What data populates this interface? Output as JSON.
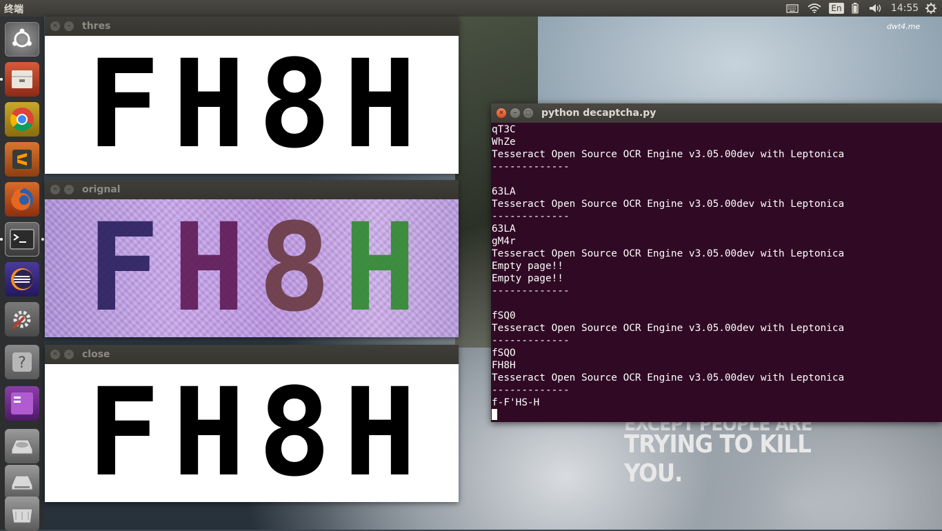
{
  "top_panel": {
    "title": "终端",
    "keyboard_indicator": "En",
    "clock": "14:55",
    "icons": [
      "keyboard-icon",
      "wifi-icon",
      "language-indicator",
      "battery-icon",
      "volume-icon",
      "gear-icon"
    ]
  },
  "launcher": {
    "items": [
      {
        "name": "ubuntu-dash-icon"
      },
      {
        "name": "files-icon"
      },
      {
        "name": "chrome-icon"
      },
      {
        "name": "sublime-text-icon"
      },
      {
        "name": "firefox-icon"
      },
      {
        "name": "terminal-icon"
      },
      {
        "name": "eclipse-icon"
      },
      {
        "name": "system-settings-icon"
      },
      {
        "name": "help-icon"
      },
      {
        "name": "workspace-switcher-icon"
      },
      {
        "name": "drive-icon"
      },
      {
        "name": "drive-icon-2"
      },
      {
        "name": "trash-icon"
      }
    ]
  },
  "windows": {
    "thres": {
      "title": "thres",
      "captcha": [
        "F",
        "H",
        "8",
        "H"
      ]
    },
    "orignal": {
      "title": "orignal",
      "captcha": [
        "F",
        "H",
        "8",
        "H"
      ],
      "colors": [
        "#2a1f5e",
        "#5e1a55",
        "#6a3a42",
        "#2f8a2f"
      ]
    },
    "close": {
      "title": "close",
      "captcha": [
        "F",
        "H",
        "8",
        "H"
      ]
    }
  },
  "terminal": {
    "title": "python decaptcha.py",
    "lines": [
      "qT3C",
      "WhZe",
      "Tesseract Open Source OCR Engine v3.05.00dev with Leptonica",
      "-------------",
      "",
      "63LA",
      "Tesseract Open Source OCR Engine v3.05.00dev with Leptonica",
      "-------------",
      "63LA",
      "gM4r",
      "Tesseract Open Source OCR Engine v3.05.00dev with Leptonica",
      "Empty page!!",
      "Empty page!!",
      "-------------",
      "",
      "fSQ0",
      "Tesseract Open Source OCR Engine v3.05.00dev with Leptonica",
      "-------------",
      "fSQO",
      "FH8H",
      "Tesseract Open Source OCR Engine v3.05.00dev with Leptonica",
      "-------------",
      "f-F'HS-H"
    ]
  },
  "wallpaper": {
    "slogan_line1": "EXCEPT PEOPLE ARE",
    "slogan_line2": "TRYING TO KILL YOU.",
    "watermark": "dwt4.me"
  },
  "colors": {
    "terminal_bg": "#300a24",
    "panel_bg": "#3c3b37",
    "close_button": "#de4a1d"
  }
}
